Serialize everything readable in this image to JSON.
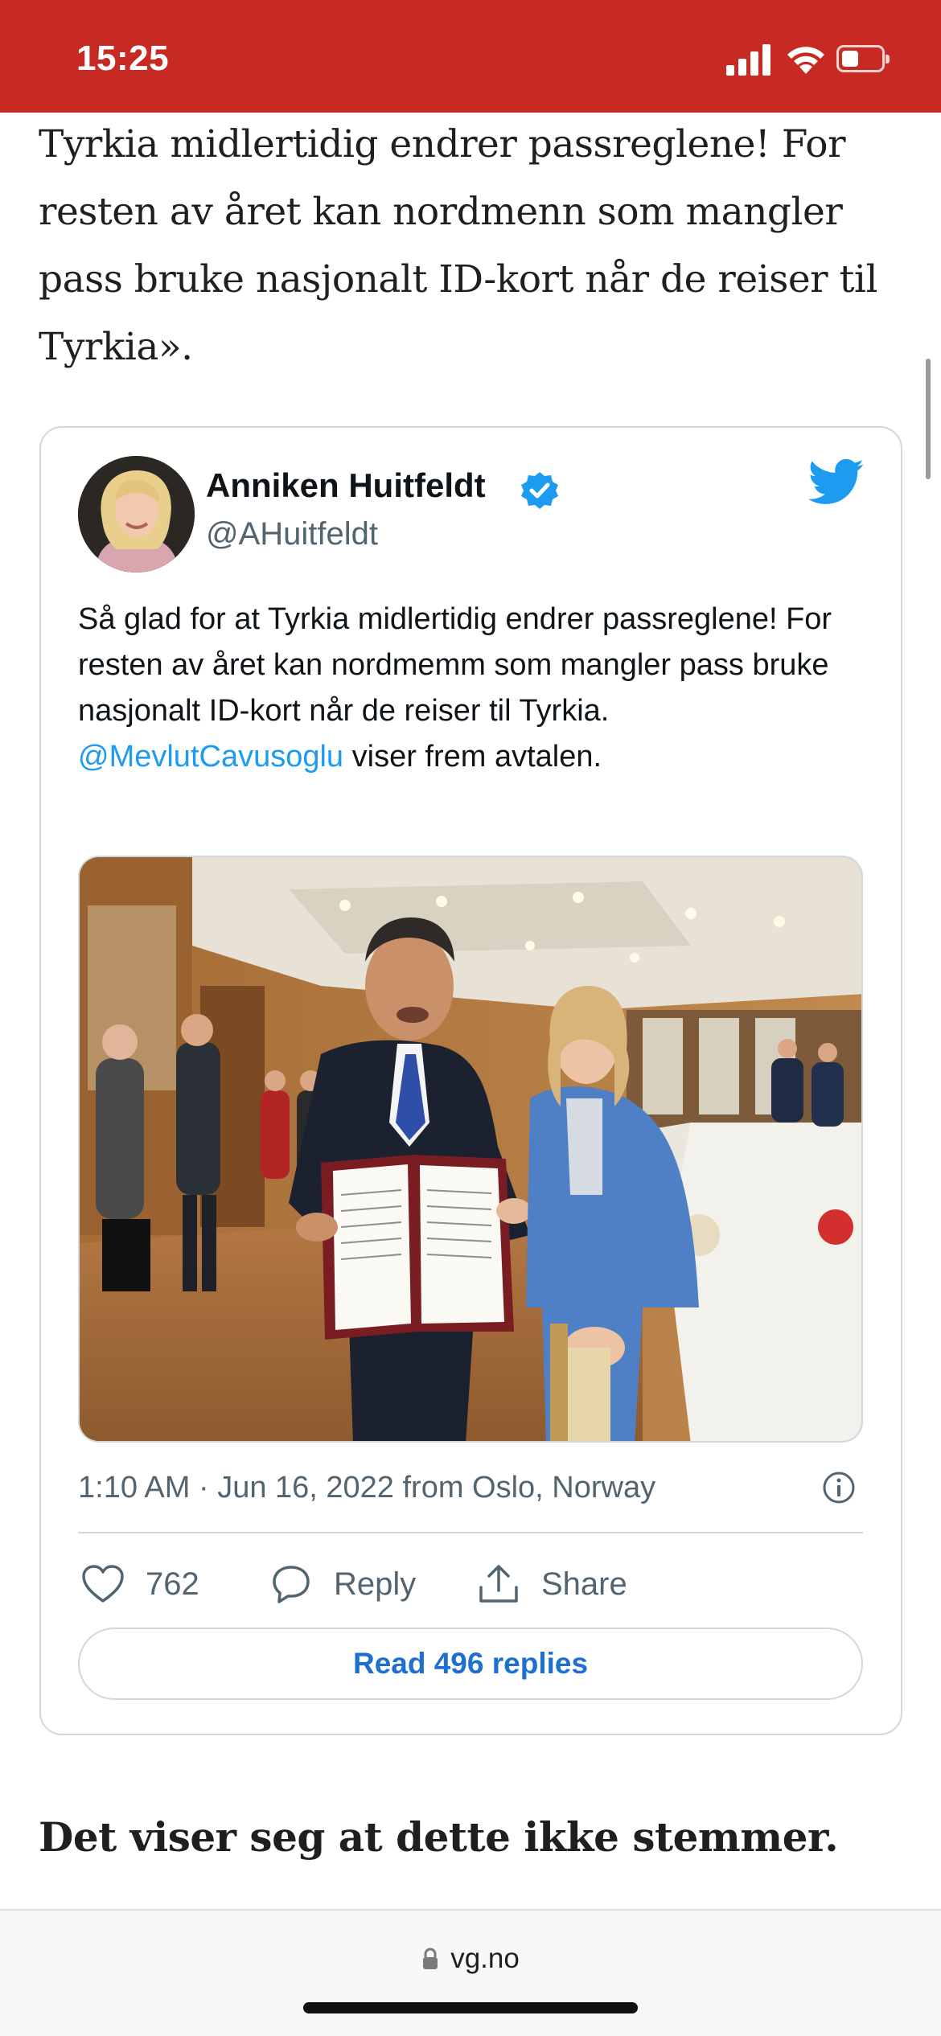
{
  "status_bar": {
    "time": "15:25",
    "background": "#c72a22"
  },
  "article": {
    "paragraph": "Tyrkia midlertidig endrer passreglene! For resten av året kan nordmenn som mangler pass bruke nasjonalt ID-kort når de reiser til Tyrkia».",
    "heading": "Det viser seg at dette ikke stemmer."
  },
  "tweet": {
    "author_name": "Anniken Huitfeldt",
    "author_handle": "@AHuitfeldt",
    "text_before_mention": "Så glad for at Tyrkia midlertidig endrer passreglene! For resten av året kan nordmemm som mangler pass bruke nasjonalt ID-kort når de reiser til Tyrkia. ",
    "mention": "@MevlutCavusoglu",
    "text_after_mention": " viser frem avtalen.",
    "timestamp": "1:10 AM · Jun 16, 2022 from Oslo, Norway",
    "like_count": "762",
    "reply_label": "Reply",
    "share_label": "Share",
    "read_replies_label": "Read 496 replies",
    "accent_color": "#1d9bf0",
    "icons": [
      "verified-badge-icon",
      "twitter-bird-icon",
      "info-icon",
      "heart-icon",
      "comment-icon",
      "share-icon"
    ]
  },
  "browser": {
    "url": "vg.no",
    "icons": [
      "lock-icon"
    ]
  }
}
